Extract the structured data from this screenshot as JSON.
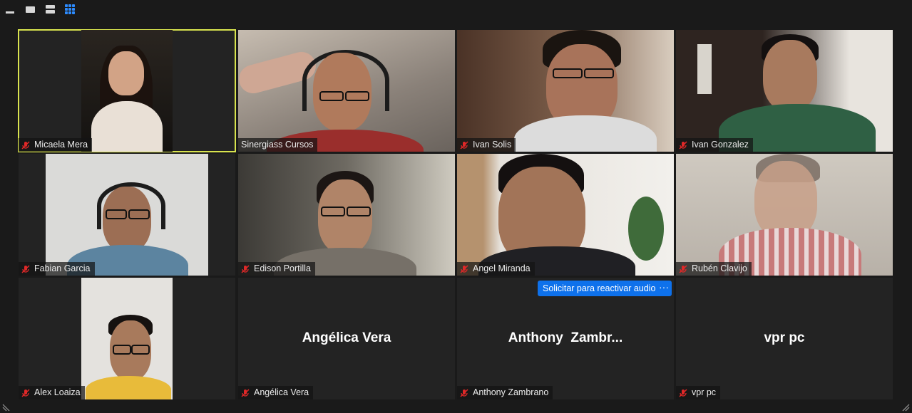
{
  "toolbar": {
    "buttons": [
      "minimize-icon",
      "single-view-icon",
      "stacked-view-icon",
      "gallery-view-icon"
    ],
    "active_color": "#2d8cff"
  },
  "participants": [
    {
      "name": "Micaela Mera",
      "muted": true,
      "active_speaker": true
    },
    {
      "name": "Sinergiass Cursos",
      "muted": false
    },
    {
      "name": "Ivan Solis",
      "muted": true
    },
    {
      "name": "Ivan Gonzalez",
      "muted": true
    },
    {
      "name": "Fabian Garcia",
      "muted": true
    },
    {
      "name": "Edison Portilla",
      "muted": true
    },
    {
      "name": "Angel Miranda",
      "muted": true
    },
    {
      "name": "Rubén Clavijo",
      "muted": true
    },
    {
      "name": "Alex Loaiza",
      "muted": true
    },
    {
      "name": "Angélica Vera",
      "muted": true,
      "display_name": "Angélica Vera"
    },
    {
      "name": "Anthony Zambrano",
      "muted": true,
      "display_name": "Anthony  Zambr..."
    },
    {
      "name": "vpr pc",
      "muted": true,
      "display_name": "vpr pc"
    }
  ],
  "unmute_request": {
    "label": "Solicitar para reactivar audio",
    "more_label": "···"
  },
  "colors": {
    "active_speaker_border": "#d8e34e",
    "muted_icon": "#e02828",
    "button_blue": "#0e71eb"
  }
}
